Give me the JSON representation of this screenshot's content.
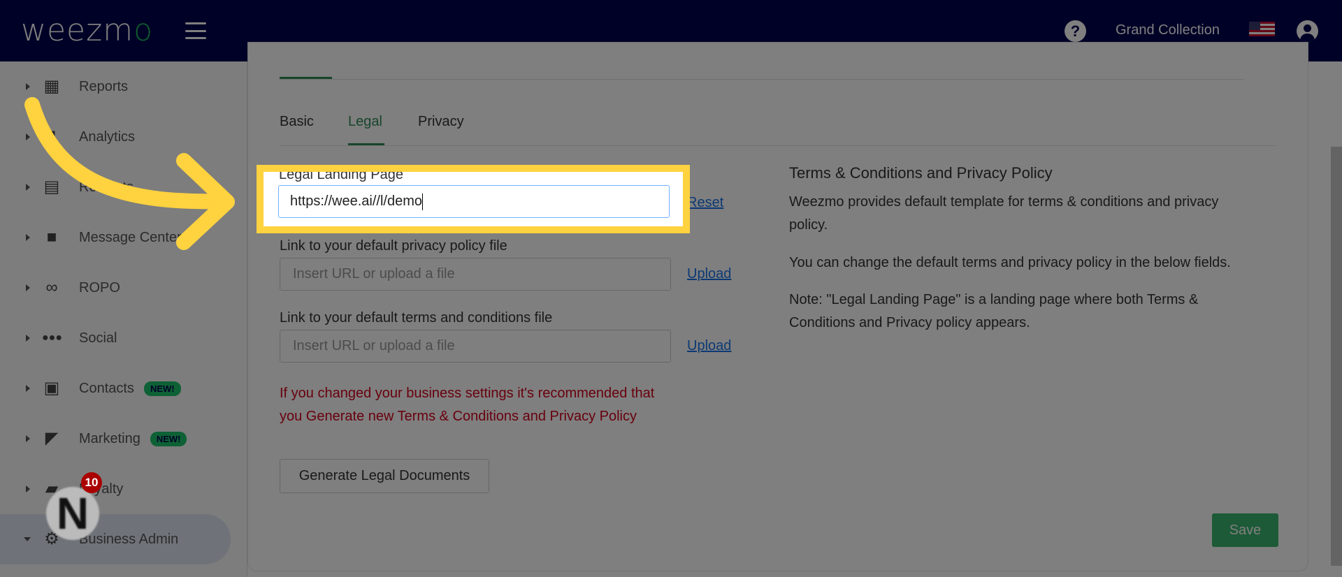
{
  "header": {
    "logo_text": "weezmo",
    "store_name": "Grand Collection",
    "help_icon": "question-circle-icon",
    "flag_icon": "us-flag-icon",
    "user_icon": "account-circle-icon"
  },
  "sidebar": {
    "items": [
      {
        "label": "Reports",
        "icon": "dashboard-icon"
      },
      {
        "label": "Analytics",
        "icon": "chart-icon"
      },
      {
        "label": "Receipts",
        "icon": "receipt-icon"
      },
      {
        "label": "Message Center",
        "icon": "chat-icon"
      },
      {
        "label": "ROPO",
        "icon": "infinity-icon"
      },
      {
        "label": "Social",
        "icon": "people-icon"
      },
      {
        "label": "Contacts",
        "icon": "contacts-icon",
        "badge": "NEW!"
      },
      {
        "label": "Marketing",
        "icon": "party-popper-icon",
        "badge": "NEW!"
      },
      {
        "label": "Loyalty",
        "icon": "loyalty-icon"
      },
      {
        "label": "Business Admin",
        "icon": "gear-icon",
        "active": true
      }
    ]
  },
  "tabs": [
    {
      "label": "Basic"
    },
    {
      "label": "Legal",
      "selected": true
    },
    {
      "label": "Privacy"
    }
  ],
  "form": {
    "legal_label": "Legal Landing Page",
    "legal_value": "https://wee.ai//l/demo",
    "reset": "Reset",
    "privacy_label": "Link to your default privacy policy file",
    "privacy_placeholder": "Insert URL or upload a file",
    "terms_label": "Link to your default terms and conditions file",
    "terms_placeholder": "Insert URL or upload a file",
    "upload": "Upload",
    "warning": "If you changed your business settings it's recommended that you Generate new Terms & Conditions and Privacy Policy",
    "generate": "Generate Legal Documents"
  },
  "info": {
    "title": "Terms & Conditions and Privacy Policy",
    "p1": "Weezmo provides default template for terms & conditions and privacy policy.",
    "p2": "You can change the default terms and privacy policy in the below fields.",
    "p3": "Note: \"Legal Landing Page\" is a landing page where both Terms & Conditions and Privacy policy appears."
  },
  "save": "Save",
  "guide": {
    "avatar_letter": "N",
    "notification_count": "10",
    "highlight_color": "#ffd23f"
  },
  "colors": {
    "header": "#00034f",
    "accent": "#2e8b57",
    "warning": "#d0021b"
  }
}
